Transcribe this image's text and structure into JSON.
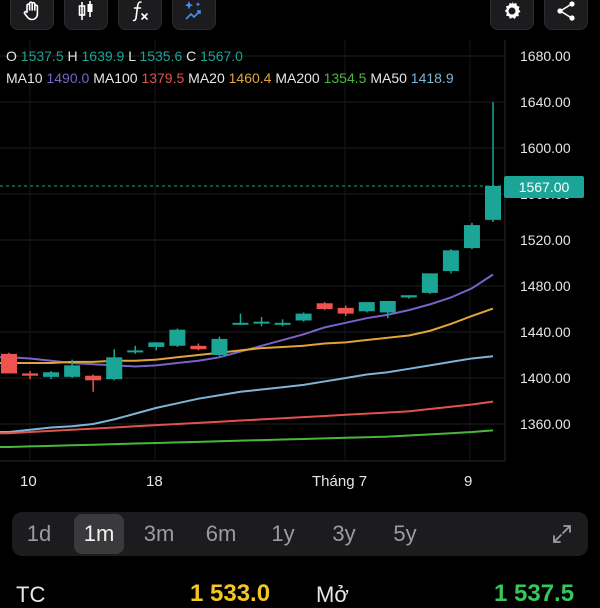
{
  "toolbar": {
    "left_icons": [
      "hand-icon",
      "candlestick-icon",
      "function-icon",
      "sparkle-chart-icon"
    ],
    "right_icons": [
      "gear-icon",
      "share-icon"
    ]
  },
  "ohlc": {
    "o_label": "O",
    "o_value": "1537.5",
    "h_label": "H",
    "h_value": "1639.9",
    "l_label": "L",
    "l_value": "1535.6",
    "c_label": "C",
    "c_value": "1567.0",
    "value_color": "#1aa596"
  },
  "ma": [
    {
      "label": "MA10",
      "value": "1490.0",
      "color": "#7b62c9"
    },
    {
      "label": "MA100",
      "value": "1379.5",
      "color": "#e0524d"
    },
    {
      "label": "MA20",
      "value": "1460.4",
      "color": "#e0a43a"
    },
    {
      "label": "MA200",
      "value": "1354.5",
      "color": "#49b83a"
    },
    {
      "label": "MA50",
      "value": "1418.9",
      "color": "#7fb4d9"
    }
  ],
  "current_price": "1567.00",
  "chart_data": {
    "type": "candlestick",
    "y_ticks": [
      "1680.00",
      "1640.00",
      "1600.00",
      "1560.00",
      "1520.00",
      "1480.00",
      "1440.00",
      "1400.00",
      "1360.00"
    ],
    "x_labels": [
      "10",
      "18",
      "Tháng 7",
      "9"
    ],
    "ylim": [
      1330,
      1690
    ],
    "candles": [
      {
        "o": 1421,
        "h": 1422,
        "l": 1404,
        "c": 1404
      },
      {
        "o": 1404,
        "h": 1406,
        "l": 1399,
        "c": 1402
      },
      {
        "o": 1401,
        "h": 1406,
        "l": 1399,
        "c": 1405
      },
      {
        "o": 1401,
        "h": 1416,
        "l": 1400,
        "c": 1411
      },
      {
        "o": 1402,
        "h": 1403,
        "l": 1388,
        "c": 1398
      },
      {
        "o": 1399,
        "h": 1425,
        "l": 1398,
        "c": 1418
      },
      {
        "o": 1424,
        "h": 1428,
        "l": 1421,
        "c": 1424
      },
      {
        "o": 1427,
        "h": 1431,
        "l": 1424,
        "c": 1431
      },
      {
        "o": 1428,
        "h": 1443,
        "l": 1427,
        "c": 1442
      },
      {
        "o": 1428,
        "h": 1430,
        "l": 1424,
        "c": 1425
      },
      {
        "o": 1420,
        "h": 1436,
        "l": 1419,
        "c": 1434
      },
      {
        "o": 1447,
        "h": 1456,
        "l": 1446,
        "c": 1448
      },
      {
        "o": 1449,
        "h": 1453,
        "l": 1445,
        "c": 1449
      },
      {
        "o": 1448,
        "h": 1451,
        "l": 1445,
        "c": 1448
      },
      {
        "o": 1450,
        "h": 1457,
        "l": 1449,
        "c": 1456
      },
      {
        "o": 1465,
        "h": 1466,
        "l": 1459,
        "c": 1460
      },
      {
        "o": 1461,
        "h": 1463,
        "l": 1454,
        "c": 1456
      },
      {
        "o": 1458,
        "h": 1465,
        "l": 1457,
        "c": 1466
      },
      {
        "o": 1457,
        "h": 1467,
        "l": 1452,
        "c": 1467
      },
      {
        "o": 1470,
        "h": 1472,
        "l": 1469,
        "c": 1472
      },
      {
        "o": 1474,
        "h": 1491,
        "l": 1473,
        "c": 1491
      },
      {
        "o": 1493,
        "h": 1512,
        "l": 1491,
        "c": 1511
      },
      {
        "o": 1513,
        "h": 1535,
        "l": 1512,
        "c": 1533
      },
      {
        "o": 1537.5,
        "h": 1639.9,
        "l": 1535.6,
        "c": 1567
      }
    ],
    "ma_series": [
      {
        "name": "MA10",
        "color": "#7b62c9",
        "values": [
          1418,
          1417,
          1415,
          1413,
          1412,
          1411,
          1410,
          1411,
          1413,
          1415,
          1418,
          1423,
          1428,
          1433,
          1438,
          1444,
          1448,
          1452,
          1455,
          1459,
          1464,
          1470,
          1478,
          1490
        ]
      },
      {
        "name": "MA20",
        "color": "#e0a43a",
        "values": [
          1413,
          1413,
          1413,
          1414,
          1414,
          1415,
          1415,
          1416,
          1418,
          1420,
          1422,
          1424,
          1426,
          1427,
          1428,
          1430,
          1431,
          1433,
          1435,
          1437,
          1441,
          1447,
          1454,
          1460.4
        ]
      },
      {
        "name": "MA50",
        "color": "#7fb4d9",
        "values": [
          1353,
          1355,
          1357,
          1358,
          1360,
          1364,
          1369,
          1374,
          1378,
          1382,
          1385,
          1388,
          1390,
          1392,
          1394,
          1397,
          1400,
          1403,
          1405,
          1408,
          1411,
          1414,
          1417,
          1418.9
        ]
      },
      {
        "name": "MA100",
        "color": "#e0524d",
        "values": [
          1352,
          1353,
          1354,
          1355,
          1356,
          1357,
          1358,
          1359,
          1360,
          1361,
          1362,
          1363,
          1364,
          1365,
          1366,
          1367,
          1368,
          1369,
          1370,
          1371,
          1373,
          1375,
          1377,
          1379.5
        ]
      },
      {
        "name": "MA200",
        "color": "#49b83a",
        "values": [
          1340,
          1340.5,
          1341,
          1341.5,
          1342,
          1342.5,
          1343,
          1343.5,
          1344,
          1344.5,
          1345,
          1345.5,
          1346,
          1346.5,
          1347,
          1347.5,
          1348,
          1348.5,
          1349,
          1350,
          1351,
          1352,
          1353,
          1354.5
        ]
      }
    ]
  },
  "timeframes": {
    "items": [
      "1d",
      "1m",
      "3m",
      "6m",
      "1y",
      "3y",
      "5y"
    ],
    "active": "1m"
  },
  "bottom": {
    "tc_label": "TC",
    "tc_value": "1 533.0",
    "mo_label": "Mở",
    "mo_value": "1 537.5"
  }
}
